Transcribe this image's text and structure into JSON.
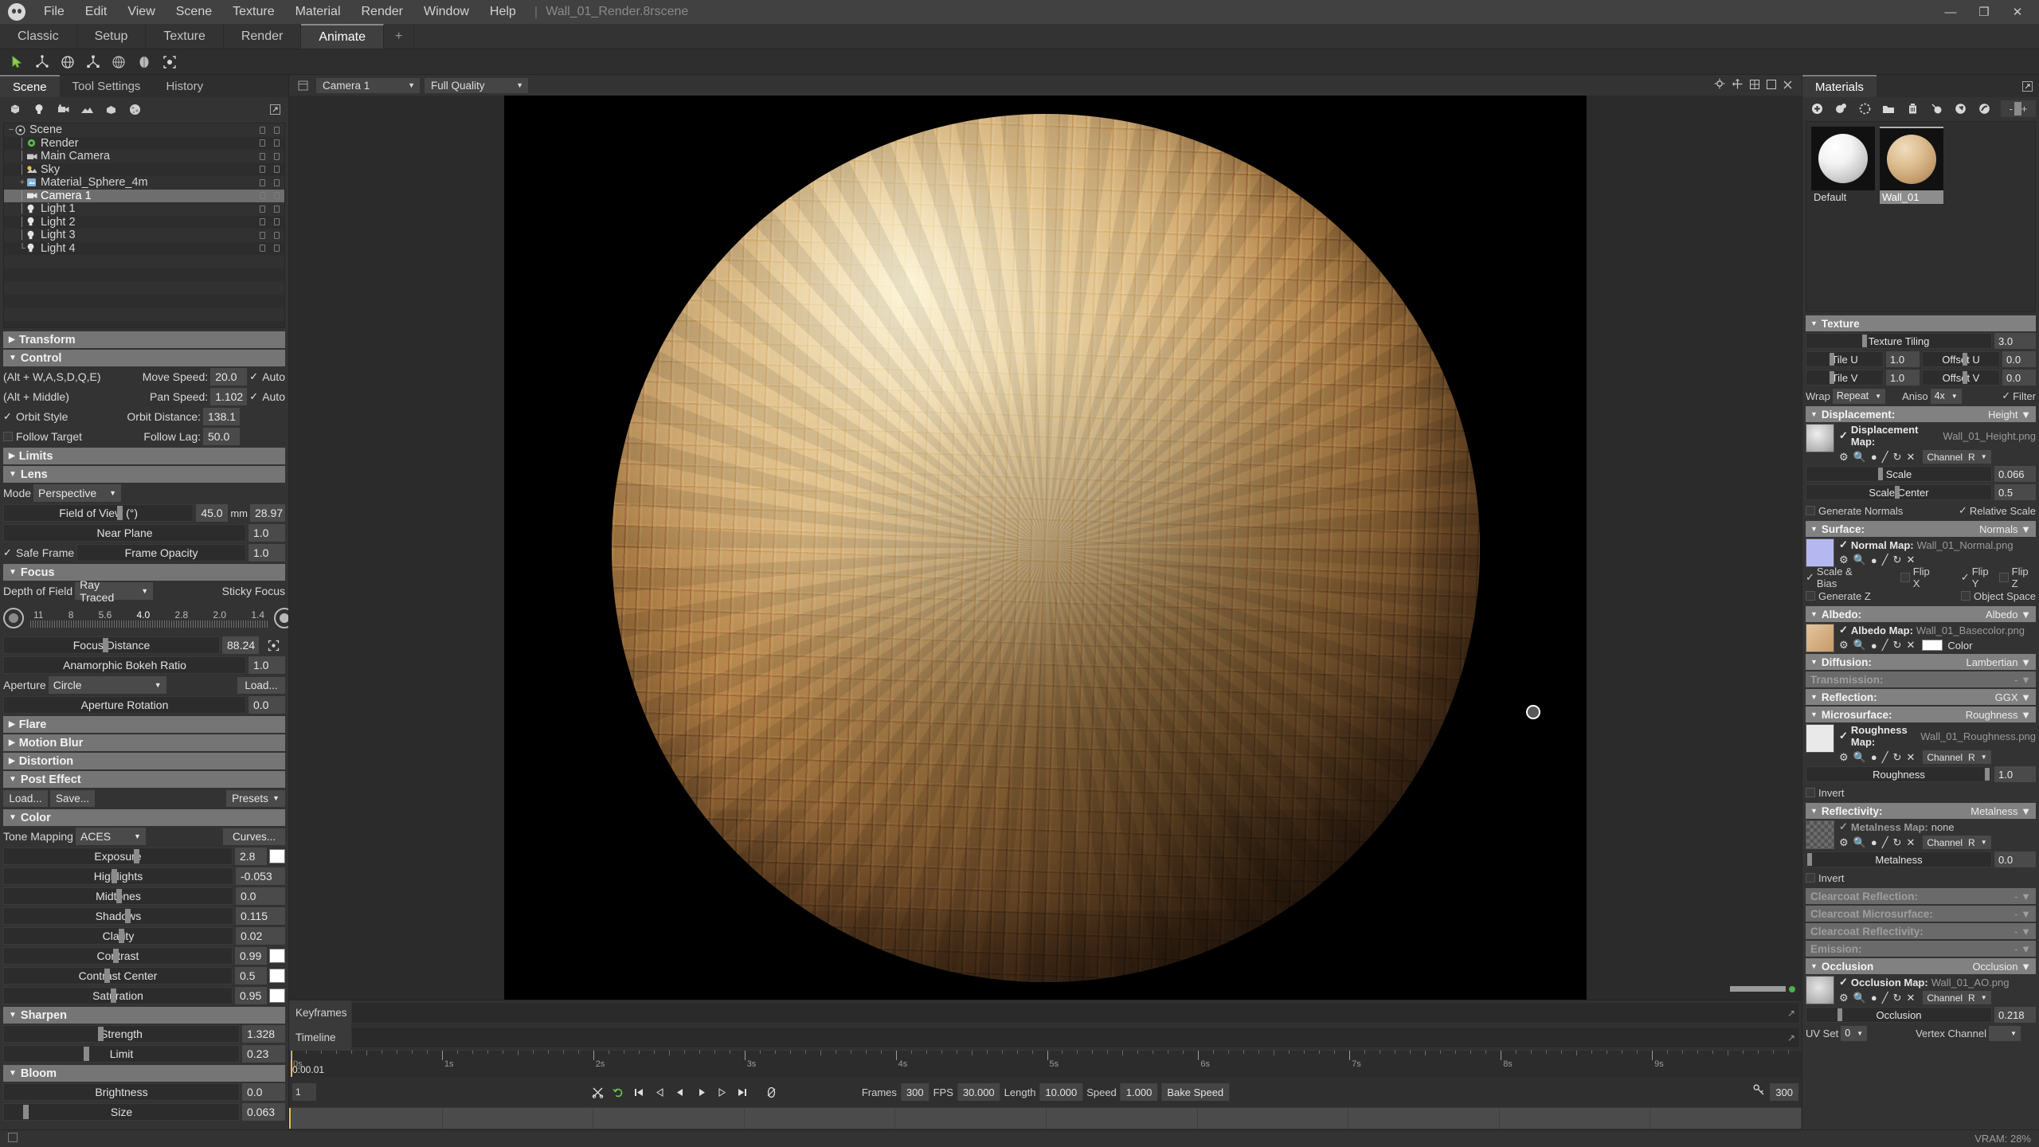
{
  "app": {
    "document_title": "Wall_01_Render.8rscene",
    "status_left": "",
    "status_right": "VRAM: 28%"
  },
  "menubar": {
    "items": [
      "File",
      "Edit",
      "View",
      "Scene",
      "Texture",
      "Material",
      "Render",
      "Window",
      "Help"
    ],
    "separator": "|",
    "window_buttons": [
      "minimize",
      "maximize",
      "close"
    ],
    "minimize_glyph": "—",
    "maximize_glyph": "❐",
    "close_glyph": "✕"
  },
  "workspace_tabs": {
    "items": [
      "Classic",
      "Setup",
      "Texture",
      "Render",
      "Animate"
    ],
    "active": "Animate",
    "add_label": "+"
  },
  "left_panel": {
    "tabs": [
      "Scene",
      "Tool Settings",
      "History"
    ],
    "active_tab": "Scene",
    "tree": [
      {
        "label": "Scene",
        "depth": 0,
        "icon": "scene-icon",
        "twisty": "−",
        "selected": false
      },
      {
        "label": "Render",
        "depth": 1,
        "icon": "render-gear-icon",
        "twisty": "├",
        "selected": false
      },
      {
        "label": "Main Camera",
        "depth": 1,
        "icon": "camera-icon",
        "twisty": "├",
        "selected": false
      },
      {
        "label": "Sky",
        "depth": 1,
        "icon": "sky-icon",
        "twisty": "├",
        "selected": false
      },
      {
        "label": "Material_Sphere_4m",
        "depth": 1,
        "icon": "mesh-icon",
        "twisty": "+",
        "selected": false
      },
      {
        "label": "Camera 1",
        "depth": 1,
        "icon": "camera-icon",
        "twisty": "├",
        "selected": true
      },
      {
        "label": "Light 1",
        "depth": 1,
        "icon": "light-icon",
        "twisty": "├",
        "selected": false
      },
      {
        "label": "Light 2",
        "depth": 1,
        "icon": "light-icon",
        "twisty": "├",
        "selected": false
      },
      {
        "label": "Light 3",
        "depth": 1,
        "icon": "light-icon",
        "twisty": "├",
        "selected": false
      },
      {
        "label": "Light 4",
        "depth": 1,
        "icon": "light-icon",
        "twisty": "└",
        "selected": false
      }
    ],
    "sections": {
      "transform": {
        "title": "Transform",
        "collapsed": true
      },
      "control": {
        "title": "Control",
        "rows": [
          {
            "left_label": "(Alt + W,A,S,D,Q,E)",
            "right_label": "Move Speed:",
            "value": "20.0",
            "check": "Auto"
          },
          {
            "left_label": "(Alt + Middle)",
            "right_label": "Pan Speed:",
            "value": "1.102",
            "check": "Auto"
          },
          {
            "left_label": "Orbit Style",
            "right_label": "Orbit Distance:",
            "value": "138.1",
            "check": ""
          },
          {
            "left_label": "Follow Target",
            "right_label": "Follow Lag:",
            "value": "50.0",
            "check": ""
          }
        ]
      },
      "limits": {
        "title": "Limits",
        "collapsed": true
      },
      "lens": {
        "title": "Lens",
        "mode_label": "Mode",
        "mode_value": "Perspective",
        "fov_label": "Field of View (°)",
        "fov_value": "45.0",
        "fov_unit": "mm",
        "fov_mm": "28.97",
        "near_plane_label": "Near Plane",
        "near_plane_value": "1.0",
        "safe_frame_label": "Safe Frame",
        "frame_opacity_label": "Frame Opacity",
        "frame_opacity_value": "1.0"
      },
      "focus": {
        "title": "Focus",
        "dof_label": "Depth of Field",
        "dof_value": "Ray Traced",
        "sticky_label": "Sticky Focus",
        "fstops": [
          "11",
          "8",
          "5.6",
          "4.0",
          "2.8",
          "2.0",
          "1.4"
        ],
        "focus_distance_label": "Focus Distance",
        "focus_distance_value": "88.24",
        "anamorphic_label": "Anamorphic Bokeh Ratio",
        "anamorphic_value": "1.0",
        "aperture_label": "Aperture",
        "aperture_value": "Circle",
        "load_label": "Load...",
        "aperture_rotation_label": "Aperture Rotation",
        "aperture_rotation_value": "0.0"
      },
      "flare": {
        "title": "Flare",
        "collapsed": true
      },
      "motion_blur": {
        "title": "Motion Blur",
        "collapsed": true
      },
      "distortion": {
        "title": "Distortion",
        "collapsed": true
      },
      "post_effect": {
        "title": "Post Effect",
        "load_label": "Load...",
        "save_label": "Save...",
        "presets_label": "Presets"
      },
      "color": {
        "title": "Color",
        "tone_mapping_label": "Tone Mapping",
        "tone_mapping_value": "ACES",
        "curves_label": "Curves...",
        "rows": [
          {
            "label": "Exposure",
            "value": "2.8",
            "swatch": "#ffffff"
          },
          {
            "label": "Highlights",
            "value": "-0.053",
            "swatch": ""
          },
          {
            "label": "Midtones",
            "value": "0.0",
            "swatch": ""
          },
          {
            "label": "Shadows",
            "value": "0.115",
            "swatch": ""
          },
          {
            "label": "Clarity",
            "value": "0.02",
            "swatch": ""
          },
          {
            "label": "Contrast",
            "value": "0.99",
            "swatch": "#ffffff"
          },
          {
            "label": "Contrast Center",
            "value": "0.5",
            "swatch": "#ffffff"
          },
          {
            "label": "Saturation",
            "value": "0.95",
            "swatch": "#ffffff"
          }
        ]
      },
      "sharpen": {
        "title": "Sharpen",
        "rows": [
          {
            "label": "Strength",
            "value": "1.328"
          },
          {
            "label": "Limit",
            "value": "0.23"
          }
        ]
      },
      "bloom": {
        "title": "Bloom",
        "rows": [
          {
            "label": "Brightness",
            "value": "0.0"
          },
          {
            "label": "Size",
            "value": "0.063"
          }
        ]
      }
    }
  },
  "viewport": {
    "camera_select": "Camera 1",
    "quality_select": "Full Quality",
    "icons": [
      "gear-icon",
      "move-icon",
      "grid-icon",
      "fullscreen-icon",
      "close-icon"
    ],
    "object_color_top": "#e2c08b",
    "object_color_mid": "#c08a4e",
    "object_color_bottom": "#7a4b29"
  },
  "timeline": {
    "keyframes_label": "Keyframes",
    "timeline_label": "Timeline",
    "timecode": "0:00.01",
    "current_frame": "1",
    "ruler_labels": [
      "0s",
      "1s",
      "2s",
      "3s",
      "4s",
      "5s",
      "6s",
      "7s",
      "8s",
      "9s"
    ],
    "transport_icons": [
      "cut-icon",
      "loop-icon",
      "jump-start-icon",
      "step-back-icon",
      "play-back-icon",
      "play-icon",
      "step-forward-icon",
      "jump-end-icon",
      "record-icon"
    ],
    "fields": [
      {
        "label": "Frames",
        "value": "300"
      },
      {
        "label": "FPS",
        "value": "30.000"
      },
      {
        "label": "Length",
        "value": "10.000"
      },
      {
        "label": "Speed",
        "value": "1.000"
      }
    ],
    "bake_speed_label": "Bake Speed",
    "end_frame": "300",
    "key_icon": "key-icon"
  },
  "materials_panel": {
    "tab_label": "Materials",
    "expand_icon": "expand-icon",
    "toolbar_icons": [
      "add-icon",
      "duplicate-icon",
      "clear-icon",
      "folder-icon",
      "trash-icon",
      "pick-icon",
      "assign-icon",
      "paint-icon"
    ],
    "search_text": "- / +",
    "items": [
      {
        "name": "Default",
        "selected": false,
        "color": "#f2f2f2"
      },
      {
        "name": "Wall_01",
        "selected": true,
        "color": "#d8b48a"
      }
    ]
  },
  "material_props": {
    "texture": {
      "title": "Texture",
      "tiling_label": "Texture Tiling",
      "tiling_value": "3.0",
      "tile_u_label": "Tile U",
      "tile_u_value": "1.0",
      "offset_u_label": "Offset U",
      "offset_u_value": "0.0",
      "tile_v_label": "Tile V",
      "tile_v_value": "1.0",
      "offset_v_label": "Offset V",
      "offset_v_value": "0.0",
      "wrap_label": "Wrap",
      "wrap_value": "Repeat",
      "aniso_label": "Aniso",
      "aniso_value": "4x",
      "filter_label": "Filter"
    },
    "displacement": {
      "title": "Displacement:",
      "mode": "Height",
      "map_label": "Displacement Map:",
      "map_file": "Wall_01_Height.png",
      "channel_label": "Channel",
      "channel_value": "R",
      "scale_label": "Scale",
      "scale_value": "0.066",
      "scale_center_label": "Scale Center",
      "scale_center_value": "0.5",
      "generate_normals_label": "Generate Normals",
      "relative_scale_label": "Relative Scale",
      "thumb_color": "#cfcfcf"
    },
    "surface": {
      "title": "Surface:",
      "mode": "Normals",
      "map_label": "Normal Map:",
      "map_file": "Wall_01_Normal.png",
      "scale_bias_label": "Scale & Bias",
      "flip_x_label": "Flip X",
      "flip_y_label": "Flip Y",
      "flip_z_label": "Flip Z",
      "generate_z_label": "Generate Z",
      "object_space_label": "Object Space",
      "thumb_color": "#b5b8f0"
    },
    "albedo": {
      "title": "Albedo:",
      "mode": "Albedo",
      "map_label": "Albedo Map:",
      "map_file": "Wall_01_Basecolor.png",
      "color_label": "Color",
      "color_value": "#ffffff",
      "thumb_color": "#dcb285"
    },
    "diffusion": {
      "title": "Diffusion:",
      "mode": "Lambertian"
    },
    "transmission": {
      "title": "Transmission:",
      "mode": "-"
    },
    "reflection": {
      "title": "Reflection:",
      "mode": "GGX"
    },
    "microsurface": {
      "title": "Microsurface:",
      "mode": "Roughness",
      "map_label": "Roughness Map:",
      "map_file": "Wall_01_Roughness.png",
      "channel_label": "Channel",
      "channel_value": "R",
      "value_label": "Roughness",
      "value": "1.0",
      "invert_label": "Invert",
      "thumb_color": "#e8e8e8"
    },
    "reflectivity": {
      "title": "Reflectivity:",
      "mode": "Metalness",
      "map_label": "Metalness Map:",
      "map_file": "none",
      "channel_label": "Channel",
      "channel_value": "R",
      "value_label": "Metalness",
      "value": "0.0",
      "invert_label": "Invert",
      "thumb_color": "#555555"
    },
    "clearcoat_reflection": {
      "title": "Clearcoat Reflection:",
      "mode": "-"
    },
    "clearcoat_microsurface": {
      "title": "Clearcoat Microsurface:",
      "mode": "-"
    },
    "clearcoat_reflectivity": {
      "title": "Clearcoat Reflectivity:",
      "mode": "-"
    },
    "emission": {
      "title": "Emission:",
      "mode": "-"
    },
    "occlusion": {
      "title": "Occlusion",
      "mode": "Occlusion",
      "map_label": "Occlusion Map:",
      "map_file": "Wall_01_AO.png",
      "channel_label": "Channel",
      "channel_value": "R",
      "value_label": "Occlusion",
      "value": "0.218",
      "uv_set_label": "UV Set",
      "uv_set_value": "0",
      "vertex_channel_label": "Vertex Channel",
      "vertex_channel_value": "",
      "thumb_color": "#c6c6c6"
    }
  }
}
